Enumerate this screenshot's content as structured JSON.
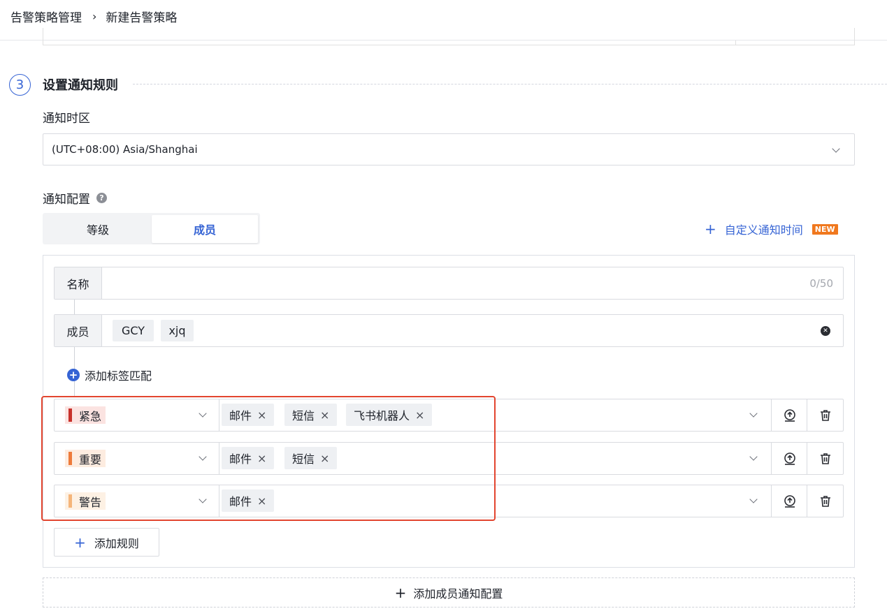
{
  "breadcrumb": {
    "parent": "告警策略管理",
    "separator": "›",
    "current": "新建告警策略"
  },
  "step": {
    "number": "3",
    "title": "设置通知规则"
  },
  "timezone": {
    "label": "通知时区",
    "value": "(UTC+08:00) Asia/Shanghai"
  },
  "notify_config": {
    "label": "通知配置",
    "help_icon": "question-circle-icon",
    "tabs": [
      {
        "label": "等级",
        "active": false
      },
      {
        "label": "成员",
        "active": true
      }
    ],
    "custom_time": {
      "label": "自定义通知时间",
      "badge": "NEW"
    }
  },
  "member_config": {
    "name_field": {
      "tag": "名称",
      "value": "",
      "count": "0/50"
    },
    "members_field": {
      "tag": "成员",
      "members": [
        "GCY",
        "xjq"
      ]
    },
    "add_tag_match": "添加标签匹配",
    "rules": [
      {
        "level": "紧急",
        "level_color": "#c8312b",
        "level_bg": "#fbe3e1",
        "channels": [
          "邮件",
          "短信",
          "飞书机器人"
        ]
      },
      {
        "level": "重要",
        "level_color": "#ee7b3b",
        "level_bg": "#fdece0",
        "channels": [
          "邮件",
          "短信"
        ]
      },
      {
        "level": "警告",
        "level_color": "#f5b57a",
        "level_bg": "#fdf1e4",
        "channels": [
          "邮件"
        ]
      }
    ],
    "chip_remove": "×",
    "add_rule": "添加规则"
  },
  "add_member_config": "添加成员通知配置",
  "colors": {
    "accent": "#3563d4",
    "highlight": "#e2452f",
    "new_badge": "#f0781e"
  }
}
